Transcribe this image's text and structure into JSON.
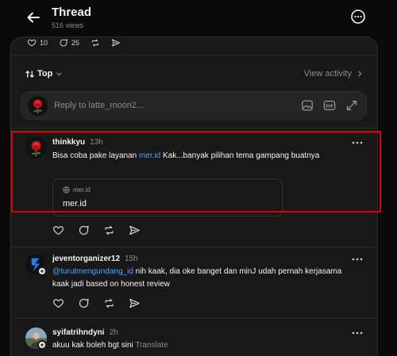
{
  "header": {
    "title": "Thread",
    "views": "516 views"
  },
  "stats": {
    "likes": "10",
    "replies": "25"
  },
  "sort": {
    "label": "Top",
    "view_activity": "View activity"
  },
  "reply": {
    "placeholder": "Reply to latte_moon2..."
  },
  "posts": [
    {
      "username": "thinkkyu",
      "time": "13h",
      "text_before": "Bisa coba pake layanan ",
      "link": "mer.id",
      "text_after": " Kak...banyak pilihan tema gampang buatnya",
      "card": {
        "domain": "mer.id",
        "title": "mer.id"
      }
    },
    {
      "username": "jeventorganizer12",
      "time": "15h",
      "mention": "@turutmengundang_id",
      "text_after": " nih kaak, dia oke banget dan minJ udah pernah kerjasama kaak jadi based on honest review"
    },
    {
      "username": "syifatrihndyni",
      "time": "2h",
      "text": "akuu kak boleh bgt sini",
      "translate": "Translate"
    }
  ],
  "colors": {
    "background": "#0a0a0a",
    "panel": "#181818",
    "link": "#4aa3ff",
    "highlight": "#e00000"
  }
}
